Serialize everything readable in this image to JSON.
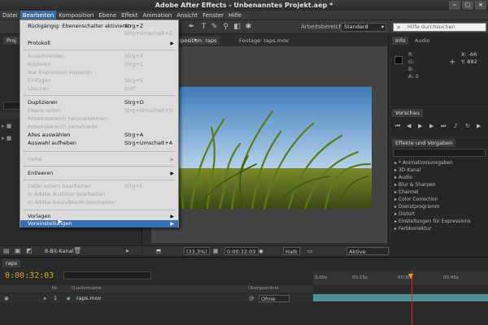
{
  "window": {
    "title": "Adobe After Effects - Unbenanntes Projekt.aep *"
  },
  "menubar": [
    "Datei",
    "Bearbeiten",
    "Komposition",
    "Ebene",
    "Effekt",
    "Animation",
    "Ansicht",
    "Fenster",
    "Hilfe"
  ],
  "toolbar": {
    "workspace_label": "Arbeitsbereich:",
    "workspace_value": "Standard",
    "help_placeholder": "Hilfe durchsuchen"
  },
  "edit_menu": {
    "undo": "Rückgängig: Ebenenschalter aktivieren",
    "undo_sc": "Strg+Z",
    "redo_sc": "Strg+Umschalt+Z",
    "history": "Protokoll",
    "cut": "Ausschneiden",
    "cut_sc": "Strg+X",
    "copy": "Kopieren",
    "copy_sc": "Strg+C",
    "copy_expr": "Nur Expression kopieren",
    "paste": "Einfügen",
    "paste_sc": "Strg+V",
    "clear": "Löschen",
    "clear_sc": "Entf",
    "duplicate": "Duplizieren",
    "duplicate_sc": "Strg+D",
    "split_layer": "Ebene teilen",
    "split_layer_sc": "Strg+Umschalt+D",
    "lift_work_area": "Arbeitsbereich herausnehmen",
    "extract_work_area": "Arbeitsbereich extrahieren",
    "select_all": "Alles auswählen",
    "select_all_sc": "Strg+A",
    "deselect_all": "Auswahl aufheben",
    "deselect_all_sc": "Strg+Umschalt+A",
    "label": "Farbe",
    "purge": "Entleeren",
    "edit_original": "Datei extern bearbeiten",
    "edit_original_sc": "Strg+E",
    "edit_audition": "In Adobe Audition bearbeiten",
    "edit_soundbooth": "In Adobe Soundbooth bearbeiten",
    "templates": "Vorlagen",
    "preferences": "Voreinstellungen"
  },
  "project_footer": {
    "bitdepth": "8-Bit-Kanal"
  },
  "comp_panel": {
    "tab_label": "Komposition: raps",
    "tab_select": "raps",
    "footage_tab": "Footage: raps.mov",
    "zoom": "(33,3%)",
    "timecode": "0:00:32:03",
    "resolution": "Halb",
    "camera": "Aktive Kamera"
  },
  "info_panel": {
    "tab": "Info",
    "audio_tab": "Audio",
    "r": "R:",
    "g": "G:",
    "b": "B:",
    "a": "A: 0",
    "x": "X: -66",
    "y": "Y: 882"
  },
  "preview_panel": {
    "tab": "Vorschau"
  },
  "effects_panel": {
    "tab": "Effekte und Vorgaben",
    "items": [
      "* Animationsvorgaben",
      "3D-Kanal",
      "Audio",
      "Blur & Sharpen",
      "Channel",
      "Color Correction",
      "Dienstprogramm",
      "Distort",
      "Einstellungen für Expressions",
      "Farbkorrektur"
    ]
  },
  "timeline": {
    "tab": "raps",
    "timecode": "0:00:32:03",
    "col_nr": "Nr.",
    "col_source": "Quellenname",
    "col_parent": "Übergeordnet",
    "layer_nr": "1",
    "layer_name": "raps.mov",
    "layer_parent": "Ohne",
    "ruler": [
      "0:00s",
      "00:15s",
      "00:30s",
      "00:45s"
    ]
  }
}
